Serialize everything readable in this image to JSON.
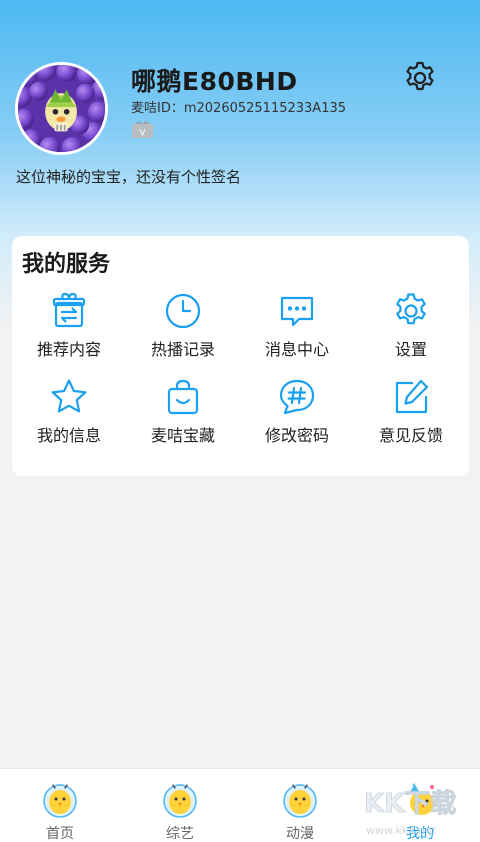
{
  "profile": {
    "nickname": "哪鹅E80BHD",
    "user_id": "麦咭ID：m20260525115233A135",
    "signature": "这位神秘的宝宝，还没有个性签名"
  },
  "services": {
    "title": "我的服务",
    "items": [
      {
        "label": "推荐内容",
        "icon": "gift-exchange-icon"
      },
      {
        "label": "热播记录",
        "icon": "clock-icon"
      },
      {
        "label": "消息中心",
        "icon": "message-bubble-icon"
      },
      {
        "label": "设置",
        "icon": "gear-icon"
      },
      {
        "label": "我的信息",
        "icon": "star-icon"
      },
      {
        "label": "麦咭宝藏",
        "icon": "shopping-bag-icon"
      },
      {
        "label": "修改密码",
        "icon": "hash-bubble-icon"
      },
      {
        "label": "意见反馈",
        "icon": "edit-icon"
      }
    ]
  },
  "tabbar": {
    "items": [
      {
        "label": "首页"
      },
      {
        "label": "综艺"
      },
      {
        "label": "动漫"
      },
      {
        "label": "我的"
      }
    ],
    "active_index": 3
  },
  "colors": {
    "accent": "#1aa0f0",
    "header_top": "#4db8f2",
    "card": "#ffffff",
    "background": "#f2f2f2"
  },
  "watermark": {
    "text": "KK下载",
    "url_text": "www.kkx.net"
  }
}
